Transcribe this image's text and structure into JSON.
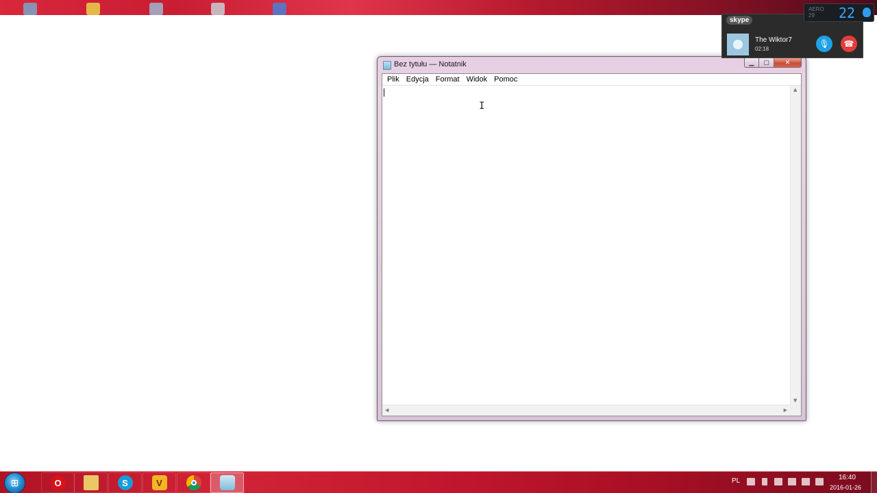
{
  "notepad": {
    "title": "Bez tytułu — Notatnik",
    "menu": [
      "Plik",
      "Edycja",
      "Format",
      "Widok",
      "Pomoc"
    ],
    "content": ""
  },
  "skype": {
    "logo": "skype",
    "contact_name": "The Wiktor7",
    "call_duration": "02:18"
  },
  "widget": {
    "label_small": "AERO",
    "value_small": "29",
    "value_big": "22"
  },
  "taskbar": {
    "apps": [
      "Opera",
      "Windows Explorer",
      "Skype",
      "Vegas",
      "Google Chrome",
      "Notepad"
    ],
    "active_app": "Notepad"
  },
  "tray": {
    "language": "PL",
    "time": "16:40",
    "date": "2016-01-26"
  },
  "colors": {
    "taskbar": "#c2172e",
    "window_frame": "#e6cde3",
    "skype_popup": "#2b2b2b",
    "skype_mic": "#1ea2e6",
    "skype_hangup": "#e53c3c"
  }
}
